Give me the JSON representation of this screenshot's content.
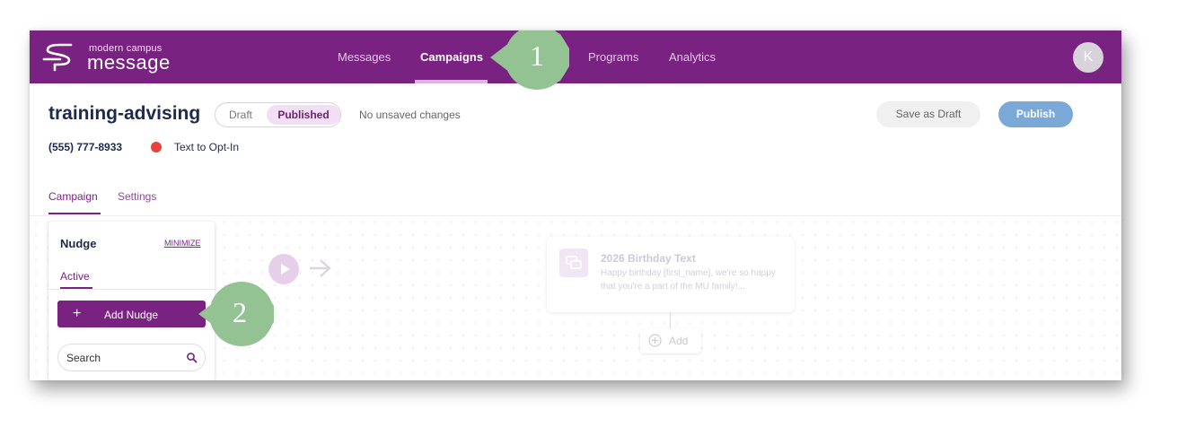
{
  "app": {
    "logo_small": "modern campus",
    "logo_big": "message",
    "avatar_initial": "K"
  },
  "nav": {
    "items": [
      {
        "label": "Messages",
        "active": false
      },
      {
        "label": "Campaigns",
        "active": true
      },
      {
        "label": "Programs",
        "active": false
      },
      {
        "label": "Analytics",
        "active": false
      }
    ]
  },
  "header": {
    "title": "training-advising",
    "status_draft": "Draft",
    "status_published": "Published",
    "unsaved_text": "No unsaved changes",
    "save_draft_label": "Save as Draft",
    "publish_label": "Publish",
    "phone": "(555) 777-8933",
    "optin_label": "Text to Opt-In"
  },
  "tabs": [
    {
      "label": "Campaign",
      "active": true
    },
    {
      "label": "Settings",
      "active": false
    }
  ],
  "nudge_panel": {
    "title": "Nudge",
    "minimize_label": "MINIMIZE",
    "active_tab": "Active",
    "add_button_label": "Add Nudge",
    "search_placeholder": "Search"
  },
  "flow": {
    "message_title": "2026 Birthday Text",
    "message_preview": "Happy birthday [first_name], we're so happy that you're a part of the MU family!...",
    "add_label": "Add"
  },
  "callouts": [
    "1",
    "2"
  ],
  "colors": {
    "brand_purple": "#7a2282",
    "publish_blue": "#7aa9d8",
    "optin_red": "#e8433a",
    "callout_green": "#93c293"
  }
}
